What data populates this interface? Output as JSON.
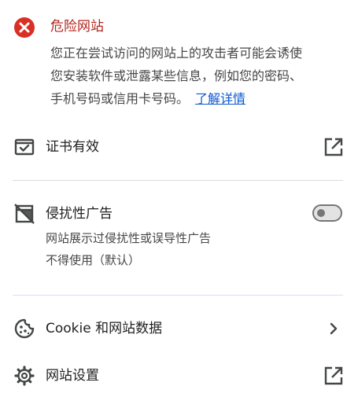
{
  "header": {
    "title": "危险网站",
    "description_lines": [
      "您正在尝试访问的网站上的攻击者可能会诱使",
      "您安装软件或泄露某些信息，例如您的密码、",
      "手机号码或信用卡号码。"
    ],
    "learn_more": "了解详情",
    "icon": "error-circle-icon",
    "color": "#b3261e"
  },
  "rows": {
    "certificate": {
      "label": "证书有效",
      "icon": "certificate-icon",
      "trailing_icon": "open-in-new-icon"
    },
    "intrusive_ads": {
      "label": "侵扰性广告",
      "icon": "ads-blocked-icon",
      "sub_lines": [
        "网站展示过侵扰性或误导性广告",
        "不得使用（默认）"
      ],
      "toggle_on": false
    },
    "cookies": {
      "label": "Cookie 和网站数据",
      "icon": "cookie-icon",
      "trailing_icon": "chevron-right-icon"
    },
    "site_settings": {
      "label": "网站设置",
      "icon": "gear-icon",
      "trailing_icon": "open-in-new-icon"
    }
  },
  "colors": {
    "danger": "#b3261e",
    "link": "#0b57d0",
    "icon": "#444746"
  }
}
